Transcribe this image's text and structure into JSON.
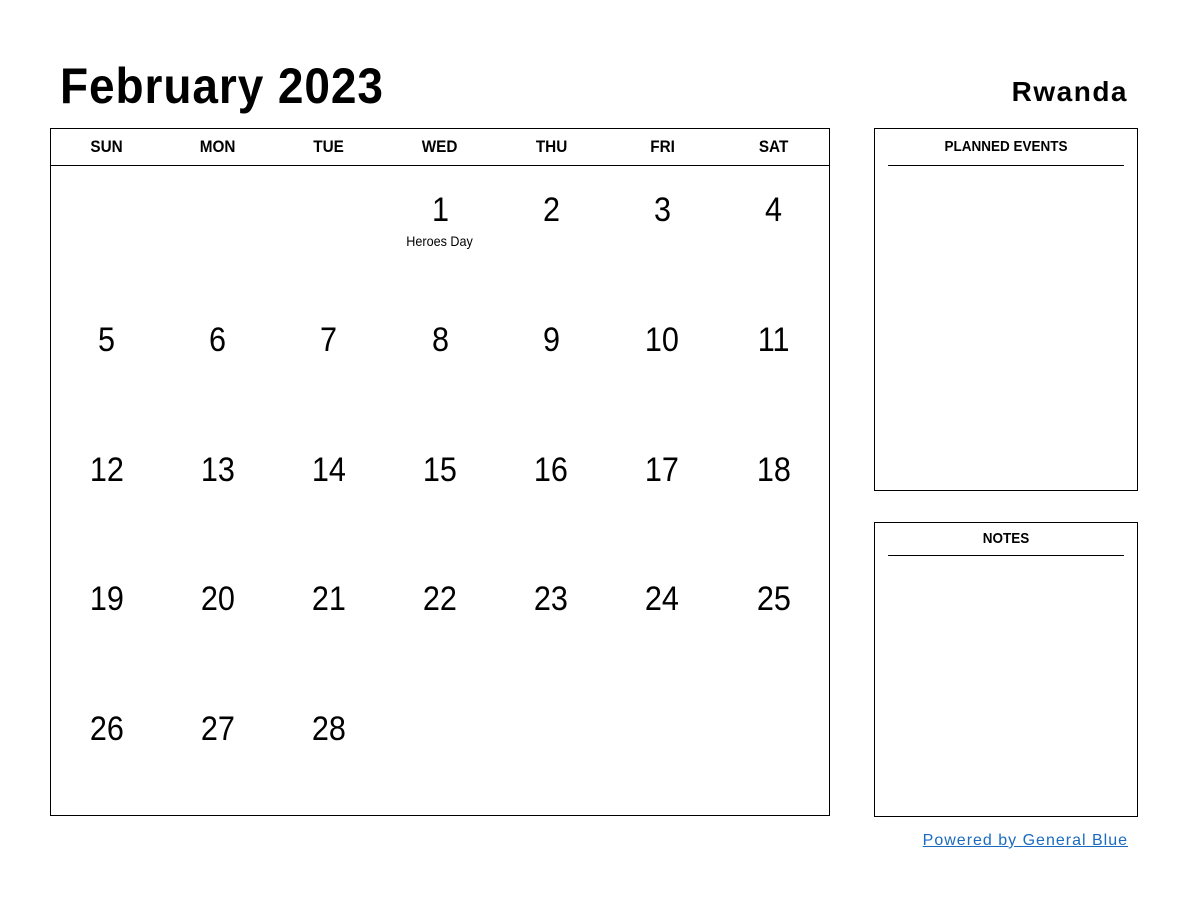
{
  "header": {
    "title": "February 2023",
    "country": "Rwanda"
  },
  "calendar": {
    "weekdays": [
      "SUN",
      "MON",
      "TUE",
      "WED",
      "THU",
      "FRI",
      "SAT"
    ],
    "cells": [
      {
        "day": "",
        "event": ""
      },
      {
        "day": "",
        "event": ""
      },
      {
        "day": "",
        "event": ""
      },
      {
        "day": "1",
        "event": "Heroes Day"
      },
      {
        "day": "2",
        "event": ""
      },
      {
        "day": "3",
        "event": ""
      },
      {
        "day": "4",
        "event": ""
      },
      {
        "day": "5",
        "event": ""
      },
      {
        "day": "6",
        "event": ""
      },
      {
        "day": "7",
        "event": ""
      },
      {
        "day": "8",
        "event": ""
      },
      {
        "day": "9",
        "event": ""
      },
      {
        "day": "10",
        "event": ""
      },
      {
        "day": "11",
        "event": ""
      },
      {
        "day": "12",
        "event": ""
      },
      {
        "day": "13",
        "event": ""
      },
      {
        "day": "14",
        "event": ""
      },
      {
        "day": "15",
        "event": ""
      },
      {
        "day": "16",
        "event": ""
      },
      {
        "day": "17",
        "event": ""
      },
      {
        "day": "18",
        "event": ""
      },
      {
        "day": "19",
        "event": ""
      },
      {
        "day": "20",
        "event": ""
      },
      {
        "day": "21",
        "event": ""
      },
      {
        "day": "22",
        "event": ""
      },
      {
        "day": "23",
        "event": ""
      },
      {
        "day": "24",
        "event": ""
      },
      {
        "day": "25",
        "event": ""
      },
      {
        "day": "26",
        "event": ""
      },
      {
        "day": "27",
        "event": ""
      },
      {
        "day": "28",
        "event": ""
      },
      {
        "day": "",
        "event": ""
      },
      {
        "day": "",
        "event": ""
      },
      {
        "day": "",
        "event": ""
      },
      {
        "day": "",
        "event": ""
      }
    ]
  },
  "sidebar": {
    "planned_events_label": "PLANNED EVENTS",
    "notes_label": "NOTES"
  },
  "footer": {
    "powered_by": "Powered by General Blue",
    "link_color": "#1a6bbf"
  }
}
